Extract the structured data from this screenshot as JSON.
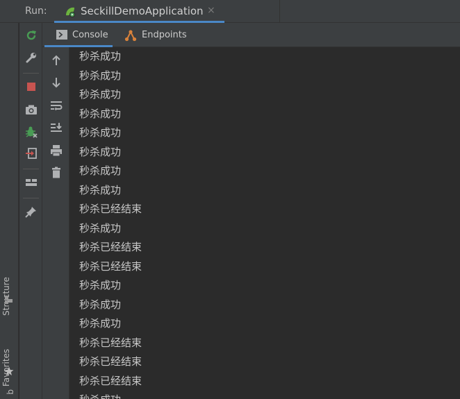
{
  "run_bar": {
    "label": "Run:",
    "tab_title": "SeckillDemoApplication",
    "tab_close": "×"
  },
  "side_strip": {
    "structure_label": "Structure",
    "favorites_label": "Favorites",
    "bottom_label": "b"
  },
  "toolbar": {
    "icons": [
      "rerun-icon",
      "wrench-icon",
      "stop-icon",
      "camera-icon",
      "debug-icon",
      "exit-icon",
      "layout-icon",
      "pin-icon"
    ]
  },
  "console_tabs": [
    {
      "label": "Console",
      "icon": "console-icon",
      "active": true
    },
    {
      "label": "Endpoints",
      "icon": "endpoints-icon",
      "active": false
    }
  ],
  "console_toolbar": {
    "icons": [
      "arrow-up-icon",
      "arrow-down-icon",
      "soft-wrap-icon",
      "scroll-to-end-icon",
      "print-icon",
      "trash-icon"
    ]
  },
  "console_lines": [
    "秒杀成功",
    "秒杀成功",
    "秒杀成功",
    "秒杀成功",
    "秒杀成功",
    "秒杀成功",
    "秒杀成功",
    "秒杀成功",
    "秒杀已经结束",
    "秒杀成功",
    "秒杀已经结束",
    "秒杀已经结束",
    "秒杀成功",
    "秒杀成功",
    "秒杀成功",
    "秒杀已经结束",
    "秒杀已经结束",
    "秒杀已经结束",
    "秒杀成功"
  ],
  "colors": {
    "accent": "#4a88c7",
    "stop_red": "#c75450",
    "rerun_green": "#499c54",
    "endpoints_orange": "#d9823b"
  }
}
